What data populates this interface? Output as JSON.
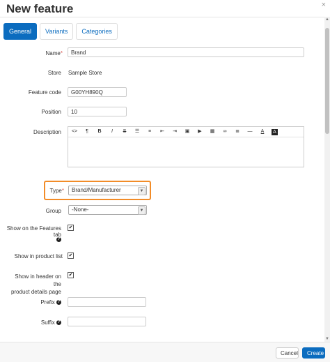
{
  "window": {
    "title": "New feature",
    "close_label": "×"
  },
  "tabs": [
    {
      "label": "General"
    },
    {
      "label": "Variants"
    },
    {
      "label": "Categories"
    }
  ],
  "form": {
    "name": {
      "label": "Name",
      "required": "*",
      "value": "Brand"
    },
    "store": {
      "label": "Store",
      "value": "Sample Store"
    },
    "feature_code": {
      "label": "Feature code",
      "value": "G00YH890Q"
    },
    "position": {
      "label": "Position",
      "value": "10"
    },
    "description": {
      "label": "Description",
      "toolbar": [
        {
          "icon": "code-icon",
          "glyph": "<>"
        },
        {
          "icon": "paragraph-icon",
          "glyph": "¶"
        },
        {
          "icon": "bold-icon",
          "glyph": "B"
        },
        {
          "icon": "italic-icon",
          "glyph": "I"
        },
        {
          "icon": "strikethrough-icon",
          "glyph": "S"
        },
        {
          "icon": "unordered-list-icon",
          "glyph": "☰"
        },
        {
          "icon": "ordered-list-icon",
          "glyph": "≡"
        },
        {
          "icon": "outdent-icon",
          "glyph": "⇤"
        },
        {
          "icon": "indent-icon",
          "glyph": "⇥"
        },
        {
          "icon": "image-icon",
          "glyph": "▣"
        },
        {
          "icon": "video-icon",
          "glyph": "▶"
        },
        {
          "icon": "table-icon",
          "glyph": "▦"
        },
        {
          "icon": "link-icon",
          "glyph": "∞"
        },
        {
          "icon": "align-icon",
          "glyph": "≣"
        },
        {
          "icon": "horizontal-rule-icon",
          "glyph": "—"
        },
        {
          "icon": "font-color-icon",
          "glyph": "A"
        },
        {
          "icon": "background-color-icon",
          "glyph": "A"
        }
      ]
    },
    "type": {
      "label": "Type",
      "required": "*",
      "value": "Brand/Manufacturer"
    },
    "group": {
      "label": "Group",
      "value": "-None-"
    },
    "show_features_tab": {
      "label": "Show on the Features tab",
      "checked": "✔"
    },
    "show_product_list": {
      "label": "Show in product list",
      "checked": "✔"
    },
    "show_header": {
      "label_line1": "Show in header on the",
      "label_line2": "product details page",
      "checked": "✔"
    },
    "prefix": {
      "label": "Prefix",
      "value": ""
    },
    "suffix": {
      "label": "Suffix",
      "value": ""
    },
    "help_glyph": "?"
  },
  "footer": {
    "cancel_label": "Cancel",
    "create_label": "Create"
  },
  "colors": {
    "accent": "#0b6cbf",
    "highlight": "#f28c28",
    "required": "#d9534f"
  }
}
